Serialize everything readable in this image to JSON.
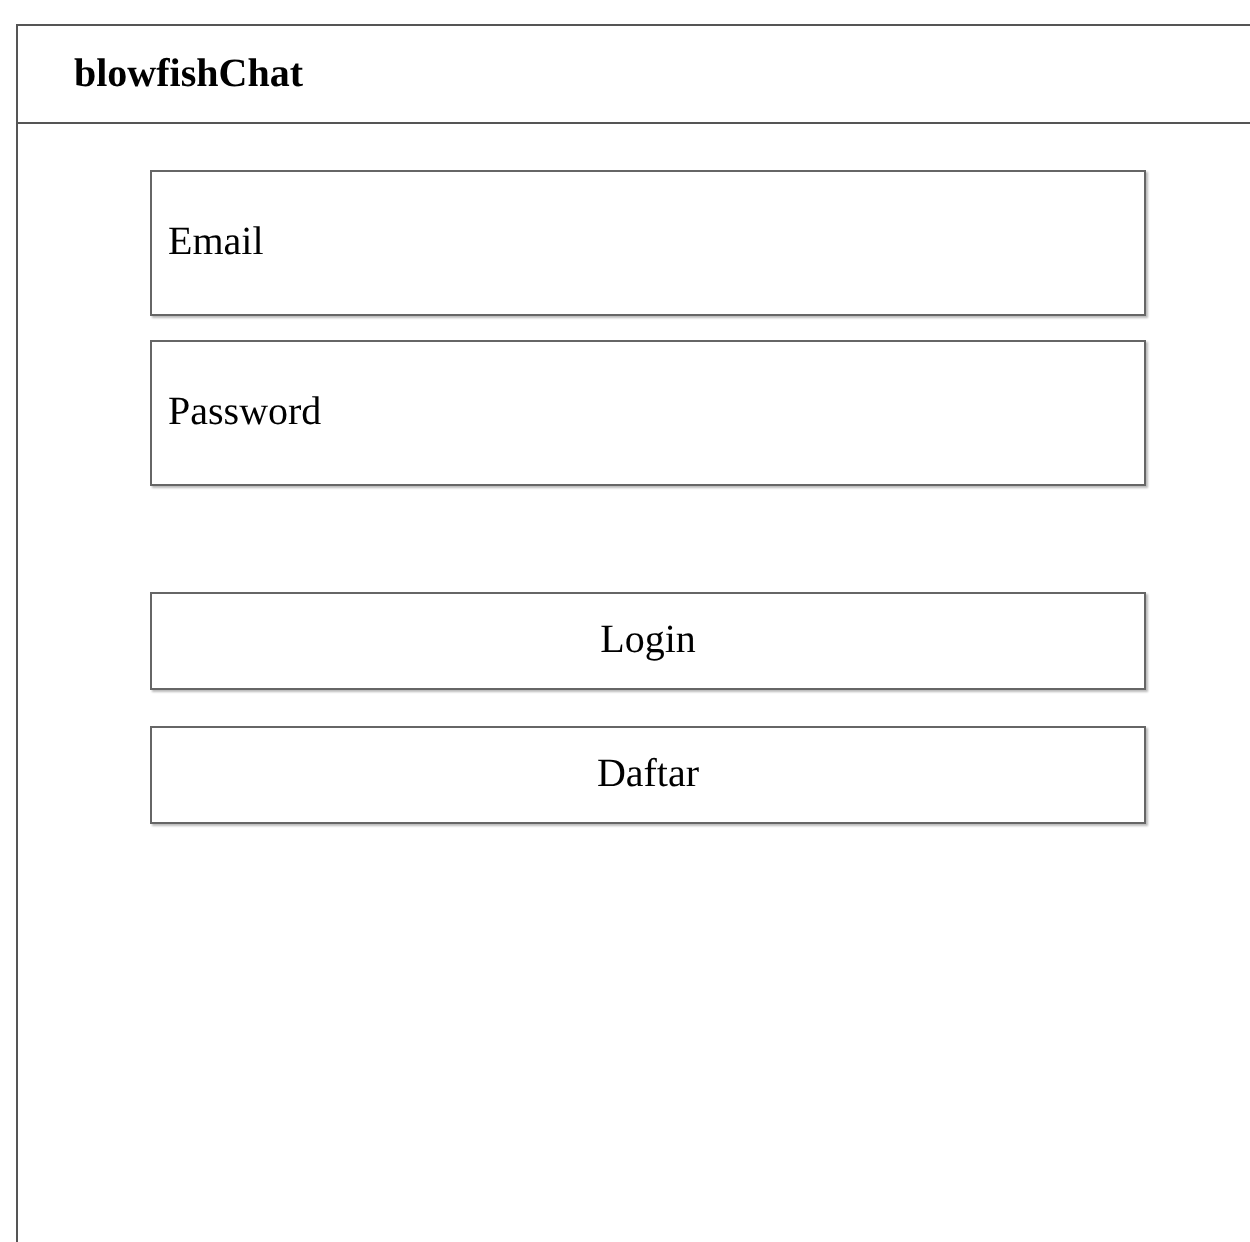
{
  "window": {
    "title": "blowfishChat"
  },
  "fields": [
    {
      "placeholder": "Email"
    },
    {
      "placeholder": "Password"
    }
  ],
  "buttons": [
    "Login",
    "Daftar"
  ]
}
